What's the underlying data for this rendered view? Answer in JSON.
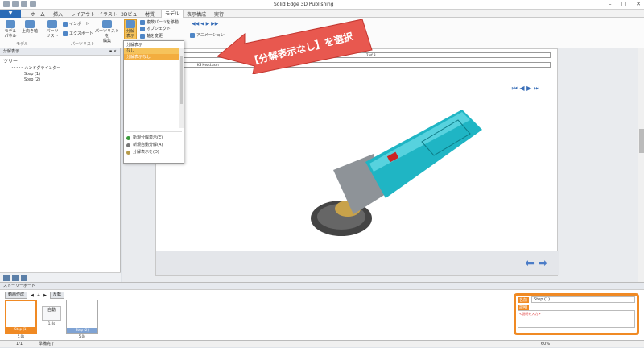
{
  "window": {
    "title": "Solid Edge 3D Publishing"
  },
  "tabs": [
    {
      "label": "ホーム"
    },
    {
      "label": "挿入"
    },
    {
      "label": "レイアウト"
    },
    {
      "label": "イラスト"
    },
    {
      "label": "3Dビュー"
    },
    {
      "label": "材質"
    },
    {
      "label": "モデル"
    },
    {
      "label": "表示構成"
    },
    {
      "label": "実行"
    }
  ],
  "ribbon": {
    "model_panel": "モデル\nパネル",
    "top_view": "上向き軸",
    "parts_list": "パーツ\nリスト",
    "import": "インポート",
    "export": "エクスポート",
    "edit_parts_list": "パーツリストを\n編集",
    "explode": "分解\n表示",
    "move_parts": "複数パーツを移動",
    "object": "オブジェクト",
    "axis_change": "軸を変更",
    "animation": "アニメーション",
    "group_model": "モデル",
    "group_parts_list": "パーツリスト"
  },
  "left_panel": {
    "title": "分解表示",
    "tree_title": "ツリー",
    "root": "••••• ハンドグラインダー",
    "steps": [
      "Step (1)",
      "Step (2)"
    ]
  },
  "document": {
    "page": "2 of 3",
    "filename": "KS Head.asm",
    "material": "素材",
    "value": "パーツ交換"
  },
  "dropdown": {
    "header": "分解表示",
    "items": [
      "なし",
      "分解表示なし"
    ],
    "commands": [
      "新規分解表示(E)",
      "新規自動分解(A)",
      "分解表示を(D)"
    ]
  },
  "callout": {
    "text": "【分解表示なし】を選択"
  },
  "storyboard": {
    "title": "ストーリーボード",
    "tool1": "動画作成",
    "tool2": "反転",
    "steps": [
      {
        "caption": "Step (1)",
        "time": "5.0s"
      },
      {
        "caption": "Step (2)",
        "time": "5.0s"
      }
    ],
    "transition": "自動",
    "transition_time": "1.0s"
  },
  "properties": {
    "name_label": "名前",
    "name_value": "Step (1)",
    "desc_label": "説明",
    "desc_value": "<説明を入力>"
  },
  "status": {
    "page": "1/1",
    "text": "準備完了",
    "zoom": "60%"
  },
  "colors": {
    "accent": "#f08a24",
    "callout": "#e8584f",
    "highlight": "#f6c35b"
  }
}
